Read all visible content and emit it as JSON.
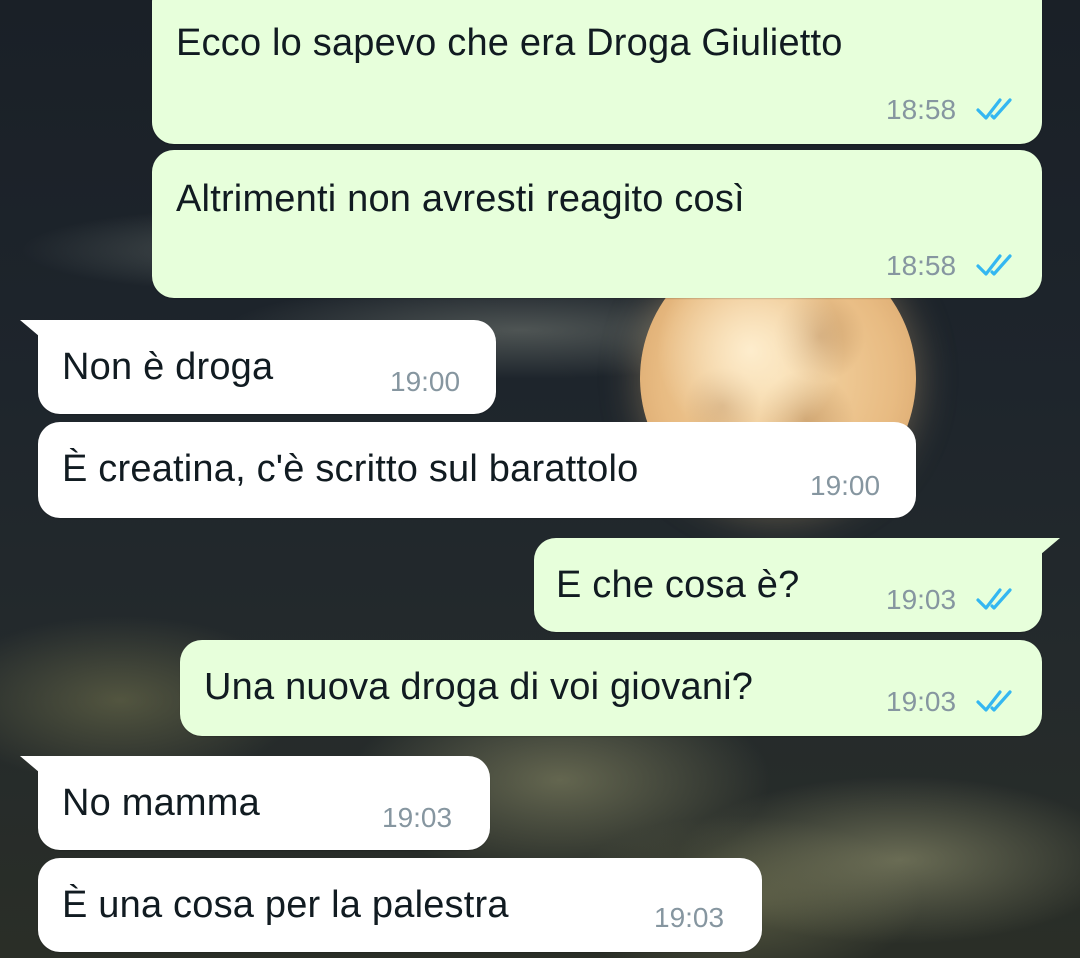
{
  "theme": {
    "outgoing_bubble": "#e7ffdb",
    "incoming_bubble": "#ffffff",
    "read_tick_color": "#34b7f1",
    "timestamp_color": "#8696a0"
  },
  "messages": [
    {
      "direction": "outgoing",
      "text": "Ecco lo sapevo che era Droga Giulietto",
      "time": "18:58",
      "status": "read"
    },
    {
      "direction": "outgoing",
      "text": "Altrimenti non avresti reagito così",
      "time": "18:58",
      "status": "read"
    },
    {
      "direction": "incoming",
      "text": "Non è droga",
      "time": "19:00"
    },
    {
      "direction": "incoming",
      "text": "È creatina, c'è scritto sul barattolo",
      "time": "19:00"
    },
    {
      "direction": "outgoing",
      "text": "E che cosa è?",
      "time": "19:03",
      "status": "read"
    },
    {
      "direction": "outgoing",
      "text": "Una nuova droga di voi giovani?",
      "time": "19:03",
      "status": "read"
    },
    {
      "direction": "incoming",
      "text": "No mamma",
      "time": "19:03"
    },
    {
      "direction": "incoming",
      "text": "È una cosa per la palestra",
      "time": "19:03"
    }
  ]
}
